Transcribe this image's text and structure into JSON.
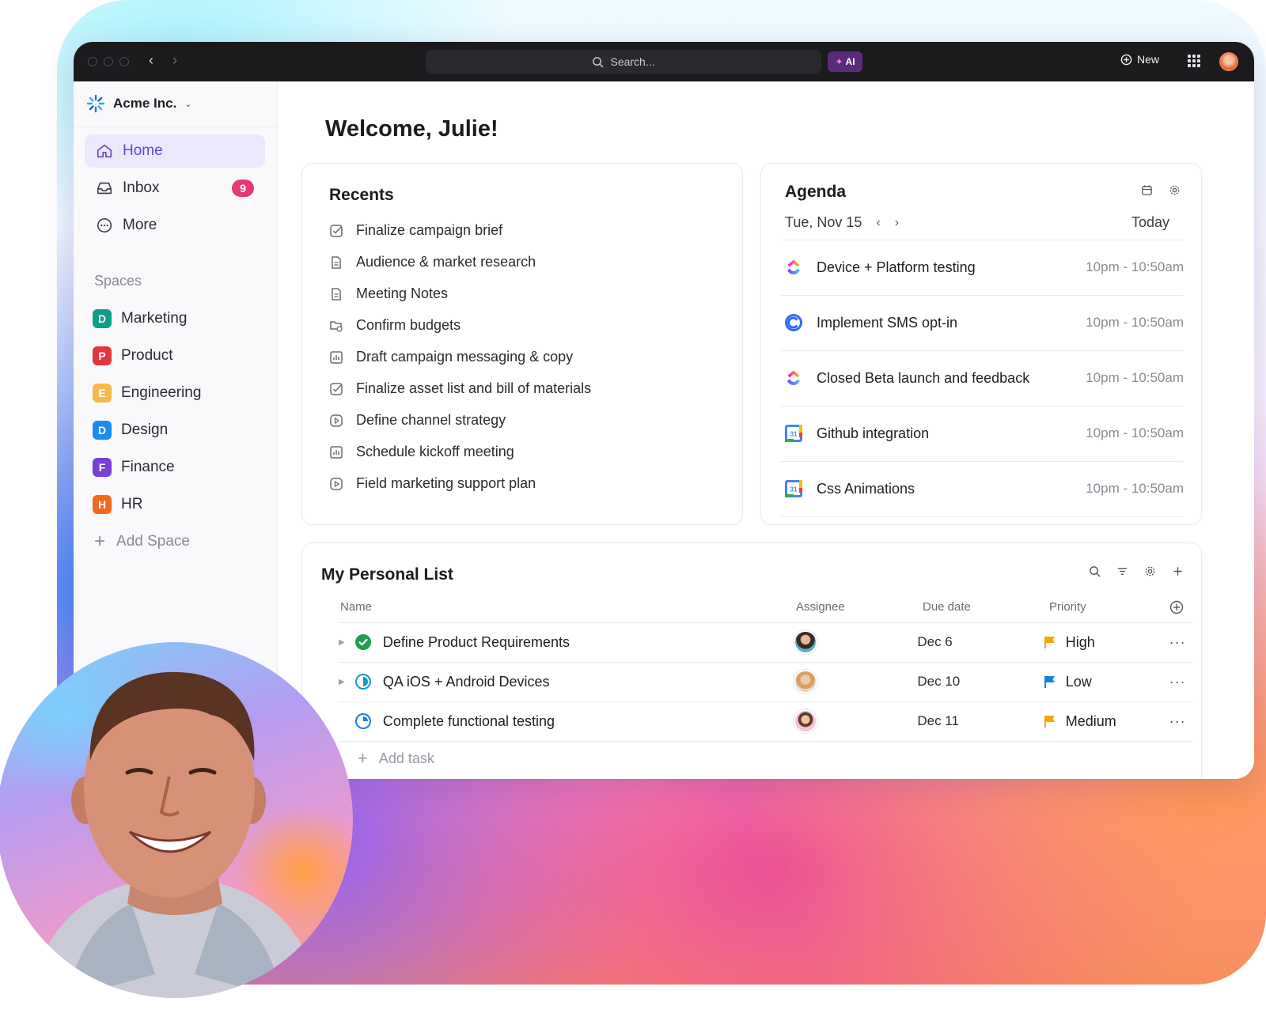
{
  "titlebar": {
    "search_placeholder": "Search...",
    "ai_label": "AI",
    "new_label": "New"
  },
  "sidebar": {
    "workspace": "Acme Inc.",
    "nav": [
      {
        "label": "Home"
      },
      {
        "label": "Inbox",
        "badge": "9"
      },
      {
        "label": "More"
      }
    ],
    "spaces_heading": "Spaces",
    "spaces": [
      {
        "letter": "D",
        "label": "Marketing",
        "color": "#0f9d8a"
      },
      {
        "letter": "P",
        "label": "Product",
        "color": "#e2363d"
      },
      {
        "letter": "E",
        "label": "Engineering",
        "color": "#f7b84b"
      },
      {
        "letter": "D",
        "label": "Design",
        "color": "#1a8cf0"
      },
      {
        "letter": "F",
        "label": "Finance",
        "color": "#7b3fd6"
      },
      {
        "letter": "H",
        "label": "HR",
        "color": "#ef6a1c"
      }
    ],
    "add_space": "Add Space"
  },
  "main": {
    "welcome": "Welcome, Julie!",
    "recents": {
      "title": "Recents",
      "items": [
        {
          "label": "Finalize campaign brief",
          "icon": "task-check-icon"
        },
        {
          "label": "Audience & market research",
          "icon": "doc-icon"
        },
        {
          "label": "Meeting Notes",
          "icon": "doc-icon"
        },
        {
          "label": "Confirm budgets",
          "icon": "folder-sync-icon"
        },
        {
          "label": "Draft campaign messaging & copy",
          "icon": "dashboard-icon"
        },
        {
          "label": "Finalize asset list and bill of materials",
          "icon": "task-check-icon"
        },
        {
          "label": "Define channel strategy",
          "icon": "play-icon"
        },
        {
          "label": "Schedule kickoff meeting",
          "icon": "dashboard-icon"
        },
        {
          "label": "Field marketing support plan",
          "icon": "play-icon"
        }
      ]
    },
    "agenda": {
      "title": "Agenda",
      "date": "Tue, Nov 15",
      "today": "Today",
      "items": [
        {
          "title": "Device + Platform testing",
          "time": "10pm - 10:50am",
          "logo": "clickup-logo-icon"
        },
        {
          "title": "Implement SMS opt-in",
          "time": "10pm - 10:50am",
          "logo": "blue-c-logo-icon"
        },
        {
          "title": "Closed Beta launch and feedback",
          "time": "10pm - 10:50am",
          "logo": "clickup-logo-icon"
        },
        {
          "title": "Github integration",
          "time": "10pm - 10:50am",
          "logo": "google-calendar-icon"
        },
        {
          "title": "Css Animations",
          "time": "10pm - 10:50am",
          "logo": "google-calendar-icon"
        }
      ]
    },
    "personal_list": {
      "title": "My Personal List",
      "columns": {
        "name": "Name",
        "assignee": "Assignee",
        "due": "Due date",
        "priority": "Priority"
      },
      "tasks": [
        {
          "name": "Define Product Requirements",
          "due": "Dec 6",
          "priority": "High",
          "priority_color": "#f5a70a",
          "status": "complete"
        },
        {
          "name": "QA iOS + Android Devices",
          "due": "Dec 10",
          "priority": "Low",
          "priority_color": "#1a7fe0",
          "status": "in-progress"
        },
        {
          "name": "Complete functional testing",
          "due": "Dec 11",
          "priority": "Medium",
          "priority_color": "#f5a70a",
          "status": "in-progress"
        }
      ],
      "add_task": "Add task"
    }
  },
  "colors": {
    "accent": "#5b4bd1",
    "active_bg": "#ebe8fb",
    "badge": "#e53975",
    "complete": "#1e9e55",
    "in_progress": "#1798c8"
  }
}
